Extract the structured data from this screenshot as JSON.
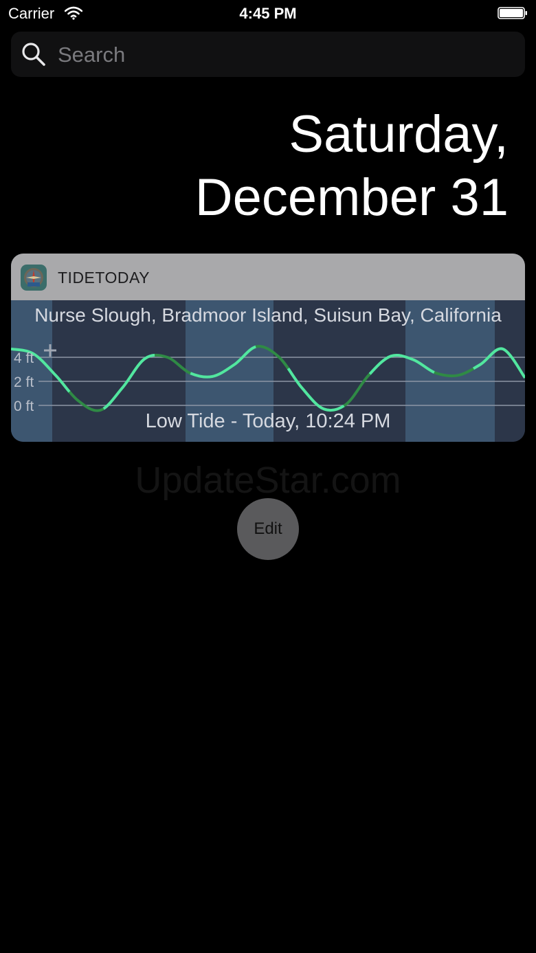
{
  "status_bar": {
    "carrier": "Carrier",
    "time": "4:45 PM"
  },
  "search": {
    "placeholder": "Search"
  },
  "date": {
    "line1": "Saturday,",
    "line2": "December 31"
  },
  "widget": {
    "app_name": "TIDETODAY",
    "location": "Nurse Slough, Bradmoor Island, Suisun Bay, California",
    "status": "Low Tide - Today, 10:24 PM",
    "y_labels": [
      "4 ft",
      "2 ft",
      "0 ft"
    ],
    "chart_data": {
      "type": "line",
      "y_ticks": [
        4,
        2,
        0
      ],
      "ylabel": "",
      "series": [
        {
          "values": [
            4.7,
            4.3,
            2.5,
            0.4,
            -0.4,
            1.5,
            3.9,
            4.0,
            2.7,
            2.4,
            3.4,
            4.9,
            4.0,
            1.5,
            -0.3,
            0.1,
            2.5,
            4.1,
            3.8,
            2.7,
            2.5,
            3.4,
            4.7,
            2.3
          ]
        }
      ]
    }
  },
  "watermark": "UpdateStar.com",
  "edit_label": "Edit"
}
